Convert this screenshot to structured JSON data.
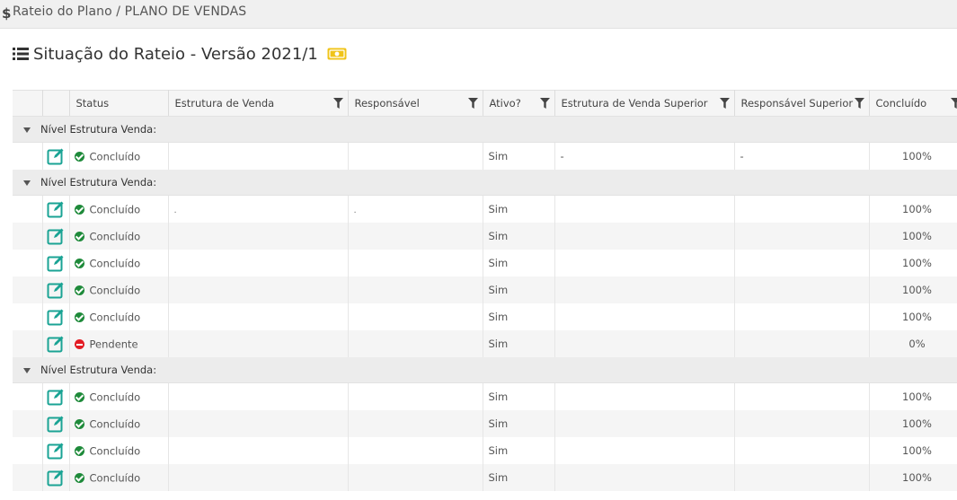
{
  "breadcrumb": {
    "text": "Rateio do Plano / PLANO DE VENDAS"
  },
  "page": {
    "title": "Situação do Rateio - Versão 2021/1"
  },
  "colors": {
    "ok": "#1e8a3a",
    "pending": "#e31b23",
    "edit": "#1aa394",
    "badge": "#f0c419"
  },
  "table": {
    "headers": {
      "status": "Status",
      "estrutura": "Estrutura de Venda",
      "responsavel": "Responsável",
      "ativo": "Ativo?",
      "estrutura_superior": "Estrutura de Venda Superior",
      "responsavel_superior": "Responsável Superior",
      "concluido": "Concluído"
    },
    "groups": [
      {
        "label": "Nível Estrutura Venda:",
        "rows": [
          {
            "status": "Concluído",
            "estrutura": "",
            "responsavel": "",
            "ativo": "Sim",
            "estrutura_superior": "-",
            "responsavel_superior": "-",
            "concluido": "100%"
          }
        ]
      },
      {
        "label": "Nível Estrutura Venda:",
        "rows": [
          {
            "status": "Concluído",
            "estrutura": ".",
            "responsavel": ".",
            "ativo": "Sim",
            "estrutura_superior": "",
            "responsavel_superior": "",
            "concluido": "100%"
          },
          {
            "status": "Concluído",
            "estrutura": "",
            "responsavel": "",
            "ativo": "Sim",
            "estrutura_superior": "",
            "responsavel_superior": "",
            "concluido": "100%"
          },
          {
            "status": "Concluído",
            "estrutura": "",
            "responsavel": "",
            "ativo": "Sim",
            "estrutura_superior": "",
            "responsavel_superior": "",
            "concluido": "100%"
          },
          {
            "status": "Concluído",
            "estrutura": "",
            "responsavel": "",
            "ativo": "Sim",
            "estrutura_superior": "",
            "responsavel_superior": "",
            "concluido": "100%"
          },
          {
            "status": "Concluído",
            "estrutura": "",
            "responsavel": "",
            "ativo": "Sim",
            "estrutura_superior": "",
            "responsavel_superior": "",
            "concluido": "100%"
          },
          {
            "status": "Pendente",
            "estrutura": "",
            "responsavel": "",
            "ativo": "Sim",
            "estrutura_superior": "",
            "responsavel_superior": "",
            "concluido": "0%"
          }
        ]
      },
      {
        "label": "Nível Estrutura Venda:",
        "rows": [
          {
            "status": "Concluído",
            "estrutura": "",
            "responsavel": "",
            "ativo": "Sim",
            "estrutura_superior": "",
            "responsavel_superior": "",
            "concluido": "100%"
          },
          {
            "status": "Concluído",
            "estrutura": "",
            "responsavel": "",
            "ativo": "Sim",
            "estrutura_superior": "",
            "responsavel_superior": "",
            "concluido": "100%"
          },
          {
            "status": "Concluído",
            "estrutura": "",
            "responsavel": "",
            "ativo": "Sim",
            "estrutura_superior": "",
            "responsavel_superior": "",
            "concluido": "100%"
          },
          {
            "status": "Concluído",
            "estrutura": "",
            "responsavel": "",
            "ativo": "Sim",
            "estrutura_superior": "",
            "responsavel_superior": "",
            "concluido": "100%"
          }
        ]
      }
    ]
  }
}
